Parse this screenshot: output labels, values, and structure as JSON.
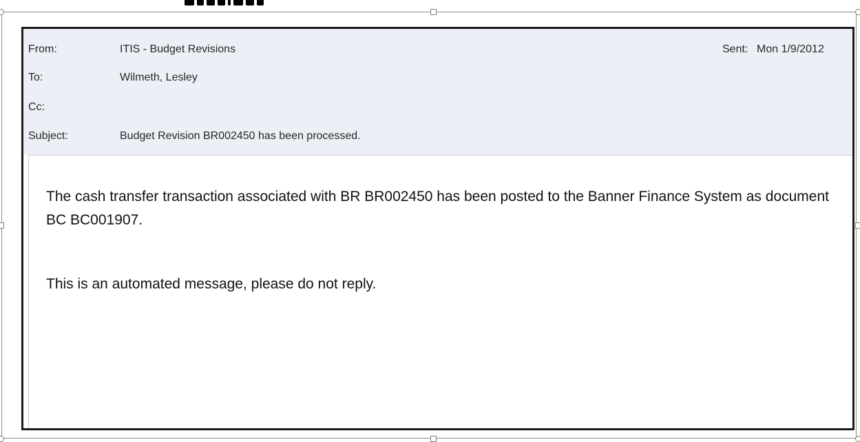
{
  "email": {
    "header": {
      "from_label": "From:",
      "from_value": "ITIS - Budget Revisions",
      "to_label": "To:",
      "to_value": "Wilmeth, Lesley",
      "cc_label": "Cc:",
      "cc_value": "",
      "subject_label": "Subject:",
      "subject_value": "Budget Revision BR002450 has been processed.",
      "sent_label": "Sent:",
      "sent_value": "Mon 1/9/2012"
    },
    "body": {
      "paragraph_1": "The cash transfer transaction associated with BR BR002450 has been posted to the Banner Finance System as document BC BC001907.",
      "paragraph_2": "This is an automated message, please do not reply."
    }
  },
  "colors": {
    "header_background": "#ecf0f6",
    "image_border": "#1a1a1a",
    "selection_frame": "#8a8a8a"
  }
}
